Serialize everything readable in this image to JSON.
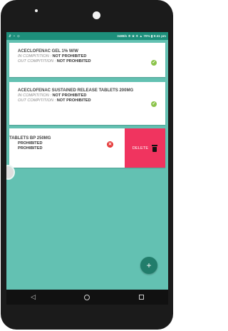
{
  "statusbar": {
    "left_icons": "⇵ • ⊙",
    "right_text": "3488/s ☀ ★ ✴ ▲ 70% ▮ 9:41 pm"
  },
  "items": [
    {
      "title": "ACECLOFENAC GEL 1% W/W",
      "in_label": "IN COMPITITION :",
      "in_value": "NOT PROHIBITED",
      "out_label": "OUT COMPITITION :",
      "out_value": "NOT PROHIBITED"
    },
    {
      "title": "ACECLOFENAC SUSTAINED RELEASE TABLETS 200MG",
      "in_label": "IN COMPITITION :",
      "in_value": "NOT PROHIBITED",
      "out_label": "OUT COMPITITION :",
      "out_value": "NOT PROHIBITED"
    },
    {
      "title": "TABLETS BP 250MG",
      "in_value": "PROHIBITED",
      "out_value": "PROHIBITED"
    }
  ],
  "delete_label": "DELETE",
  "icons": {
    "check": "check-circle-icon",
    "x": "x-circle-icon",
    "trash": "trash-icon",
    "fab": "plus"
  },
  "fab_glyph": "+",
  "colors": {
    "background": "#63c1b2",
    "statusbar": "#1d8f7b",
    "delete": "#f0345f",
    "check": "#8bc34a",
    "fab": "#217d6b"
  }
}
